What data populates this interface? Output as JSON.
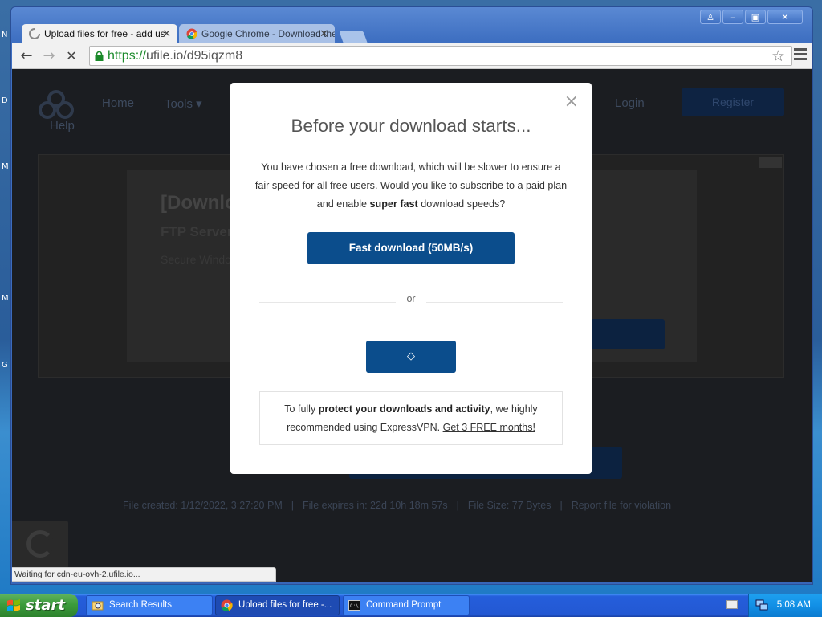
{
  "desktop": {
    "left_letters": [
      "N",
      "D",
      "M",
      "M",
      "G"
    ]
  },
  "window": {
    "controls": {
      "help": "♙",
      "minimize": "–",
      "maximize": "▣",
      "close": "✕"
    }
  },
  "tabs": [
    {
      "title": "Upload files for free - add us",
      "icon": "loading-spinner-icon",
      "active": true
    },
    {
      "title": "Google Chrome - Download the",
      "icon": "chrome-icon",
      "active": false
    }
  ],
  "toolbar": {
    "url_scheme": "https://",
    "url_rest": "ufile.io/d95iqzm8",
    "back_glyph": "←",
    "forward_glyph": "→",
    "stop_glyph": "✕",
    "star_glyph": "☆"
  },
  "background_page": {
    "nav": [
      "Home",
      "Tools ▾"
    ],
    "help": "Help",
    "login": "Login",
    "register": "Register",
    "ad": {
      "title": "[Downlo",
      "subtitle": "FTP Server",
      "text": "Secure Windo"
    },
    "footer": {
      "created": "File created: 1/12/2022, 3:27:20 PM",
      "expires": "File expires in: 22d 10h 18m 57s",
      "size": "File Size: 77 Bytes",
      "report": "Report file for violation",
      "separator": "|"
    }
  },
  "status_bar": "Waiting for cdn-eu-ovh-2.ufile.io...",
  "modal": {
    "close_glyph": "×",
    "title": "Before your download starts...",
    "body_part1": "You have chosen a free download, which will be slower to ensure a fair speed for all free users. Would you like to subscribe to a paid plan and enable ",
    "body_bold": "super fast",
    "body_part2": " download speeds?",
    "fast_button": "Fast download (50MB/s)",
    "or": "or",
    "slow_button_glyph": "◇",
    "vpn_part1": "To fully ",
    "vpn_bold": "protect your downloads and activity",
    "vpn_part2": ", we highly recommended using ExpressVPN. ",
    "vpn_link": "Get 3 FREE months!"
  },
  "taskbar": {
    "start": "start",
    "tasks": [
      {
        "label": "Search Results",
        "icon": "folder-search-icon",
        "active": false
      },
      {
        "label": "Upload files for free -...",
        "icon": "chrome-icon",
        "active": true
      },
      {
        "label": "Command Prompt",
        "icon": "command-prompt-icon",
        "active": false
      }
    ],
    "clock": "5:08 AM"
  },
  "colors": {
    "accent_button": "#0b4d8c",
    "secure_green": "#1a8a2a",
    "xp_taskbar": "#245edb",
    "xp_start": "#3c9c3c"
  }
}
